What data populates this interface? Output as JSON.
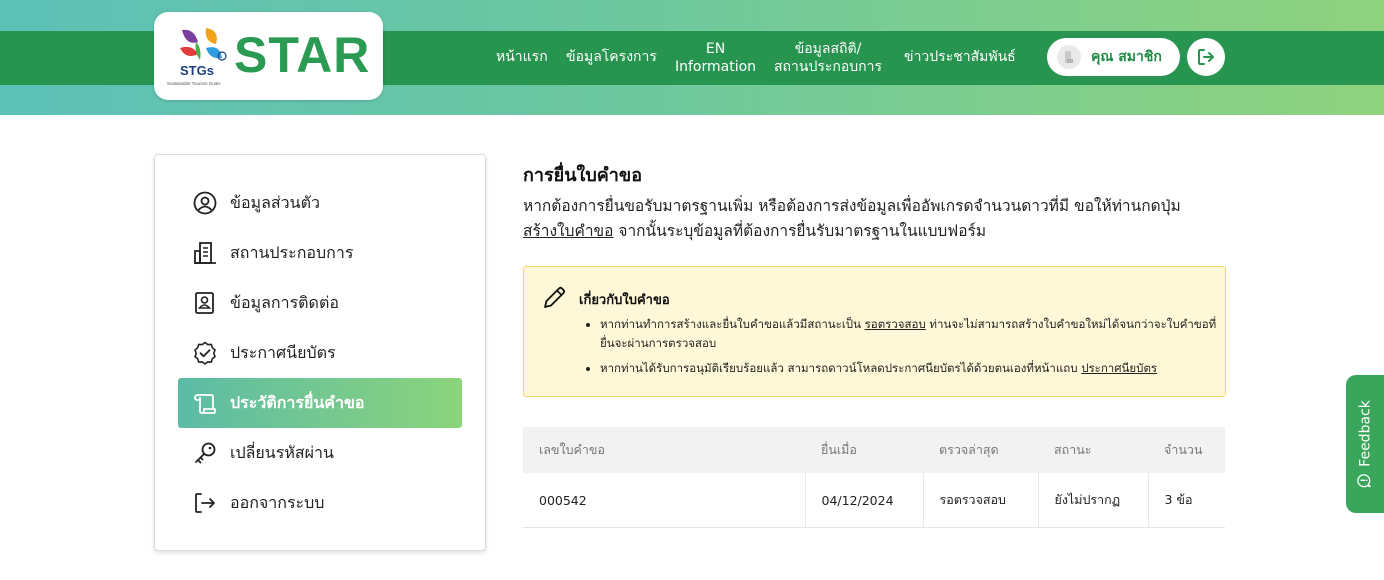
{
  "header": {
    "logo": {
      "mark": "STGs",
      "tagline": "Sustainable Tourism Goals",
      "wordmark": "STAR"
    },
    "nav": [
      {
        "label": "หน้าแรก"
      },
      {
        "label": "ข้อมูลโครงการ"
      },
      {
        "label_line1": "EN",
        "label_line2": "Information"
      },
      {
        "label_line1": "ข้อมูลสถิติ/",
        "label_line2": "สถานประกอบการ"
      },
      {
        "label": "ข่าวประชาสัมพันธ์"
      }
    ],
    "member": {
      "name": "คุณ สมาชิก",
      "avatar_icon": "user-avatar"
    },
    "logout_icon": "logout-icon"
  },
  "sidebar": {
    "items": [
      {
        "label": "ข้อมูลส่วนตัว",
        "icon": "user-circle-icon",
        "active": false
      },
      {
        "label": "สถานประกอบการ",
        "icon": "building-icon",
        "active": false
      },
      {
        "label": "ข้อมูลการติดต่อ",
        "icon": "contact-book-icon",
        "active": false
      },
      {
        "label": "ประกาศนียบัตร",
        "icon": "badge-check-icon",
        "active": false
      },
      {
        "label": "ประวัติการยื่นคำขอ",
        "icon": "scroll-icon",
        "active": true
      },
      {
        "label": "เปลี่ยนรหัสผ่าน",
        "icon": "key-icon",
        "active": false
      },
      {
        "label": "ออกจากระบบ",
        "icon": "logout-icon",
        "active": false
      }
    ]
  },
  "main": {
    "title": "การยื่นใบคำขอ",
    "desc_part1": "หากต้องการยื่นขอรับมาตรฐานเพิ่ม หรือต้องการส่งข้อมูลเพื่ออัพเกรดจำนวนดาวที่มี ขอให้ท่านกดปุ่ม",
    "desc_link": "สร้างใบคำขอ",
    "desc_part2": " จากนั้นระบุข้อมูลที่ต้องการยื่นรับมาตรฐานในแบบฟอร์ม",
    "notice": {
      "icon": "pencil-icon",
      "title": "เกี่ยวกับใบคำขอ",
      "bullet1_part1": "หากท่านทำการสร้างและยื่นใบคำขอแล้วมีสถานะเป็น ",
      "bullet1_link": "รอตรวจสอบ",
      "bullet1_part2": " ท่านจะไม่สามารถสร้างใบคำขอใหม่ได้จนกว่าจะใบคำขอที่ยื่นจะผ่านการตรวจสอบ",
      "bullet2_part1": "หากท่านได้รับการอนุมัติเรียบร้อยแล้ว สามารถดาวน์โหลดประกาศนียบัตรได้ด้วยตนเองที่หน้าแถบ ",
      "bullet2_link": "ประกาศนียบัตร"
    },
    "table": {
      "headers": [
        "เลขใบคำขอ",
        "ยื่นเมื่อ",
        "ตรวจล่าสุด",
        "สถานะ",
        "จำนวน"
      ],
      "rows": [
        [
          "000542",
          "04/12/2024",
          "รอตรวจสอบ",
          "ยังไม่ปรากฏ",
          "3 ข้อ"
        ]
      ]
    }
  },
  "feedback": {
    "label": "Feedback",
    "icon": "chat-bubble-icon"
  },
  "colors": {
    "brand_green": "#27944f",
    "accent_gradient_start": "#5cbba6",
    "accent_gradient_end": "#8bd47b",
    "notice_bg": "#fff8d8"
  }
}
